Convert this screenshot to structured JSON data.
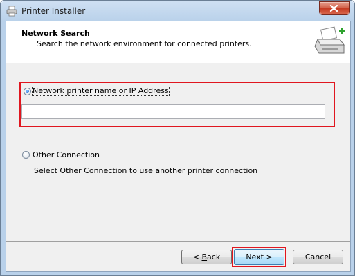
{
  "window": {
    "title": "Printer Installer"
  },
  "header": {
    "title": "Network Search",
    "subtitle": "Search the network environment for connected printers."
  },
  "options": {
    "network": {
      "label": "Network printer name or IP Address",
      "selected": true,
      "input_value": ""
    },
    "other": {
      "label": "Other Connection",
      "selected": false,
      "description": "Select Other Connection to use another printer connection"
    }
  },
  "buttons": {
    "back_prefix": "< ",
    "back_mnemonic": "B",
    "back_rest": "ack",
    "next": "Next >",
    "cancel": "Cancel"
  },
  "icons": {
    "app": "printer-icon",
    "header": "printer-add-icon",
    "close": "close-icon"
  },
  "colors": {
    "highlight": "#e0161f",
    "close_button": "#c53a22"
  }
}
